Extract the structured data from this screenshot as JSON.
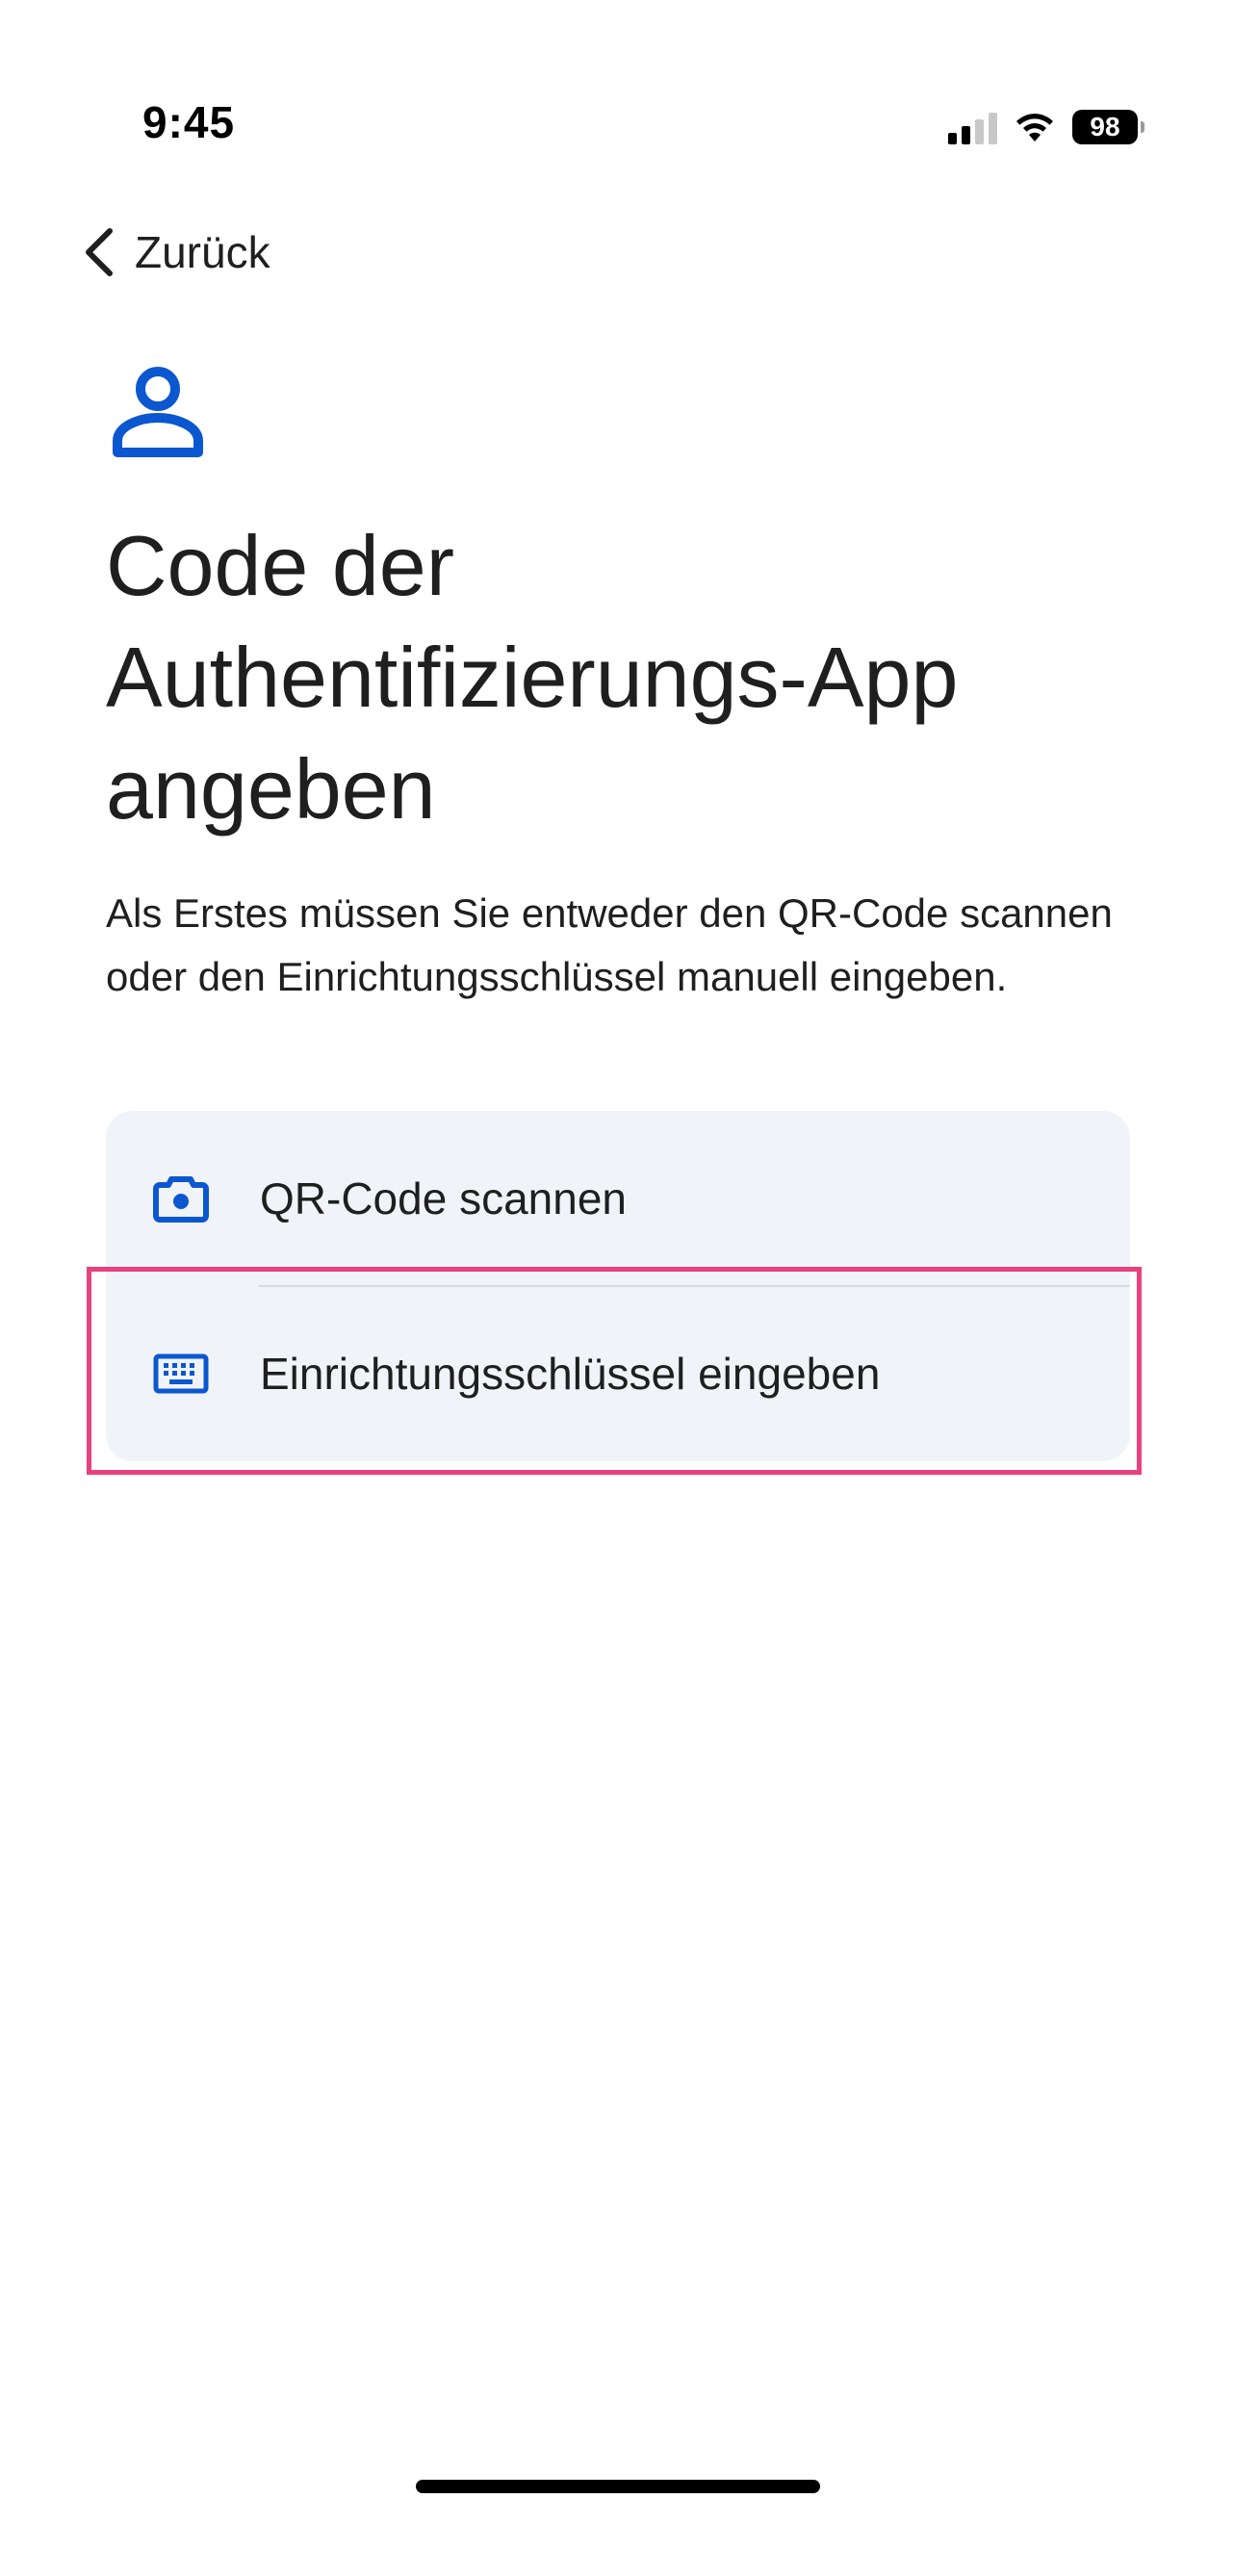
{
  "status_bar": {
    "time": "9:45",
    "battery_level": "98",
    "signal_bars_active": 2,
    "signal_bars_total": 4
  },
  "nav": {
    "back_label": "Zurück",
    "back_icon": "chevron-left-icon"
  },
  "header": {
    "icon": "person-icon",
    "title_lines": [
      "Code der",
      "Authentifizierungs-App",
      "angeben"
    ]
  },
  "description": "Als Erstes müssen Sie entweder den QR-Code scannen oder den Einrichtungsschlüssel manuell eingeben.",
  "options": [
    {
      "label": "QR-Code scannen",
      "icon": "camera-icon"
    },
    {
      "label": "Einrichtungsschlüssel eingeben",
      "icon": "keyboard-icon"
    }
  ],
  "colors": {
    "accent": "#0b57d0",
    "card_background": "#f0f4f9",
    "highlight": "#e8417f",
    "text": "#1f1f1f"
  }
}
